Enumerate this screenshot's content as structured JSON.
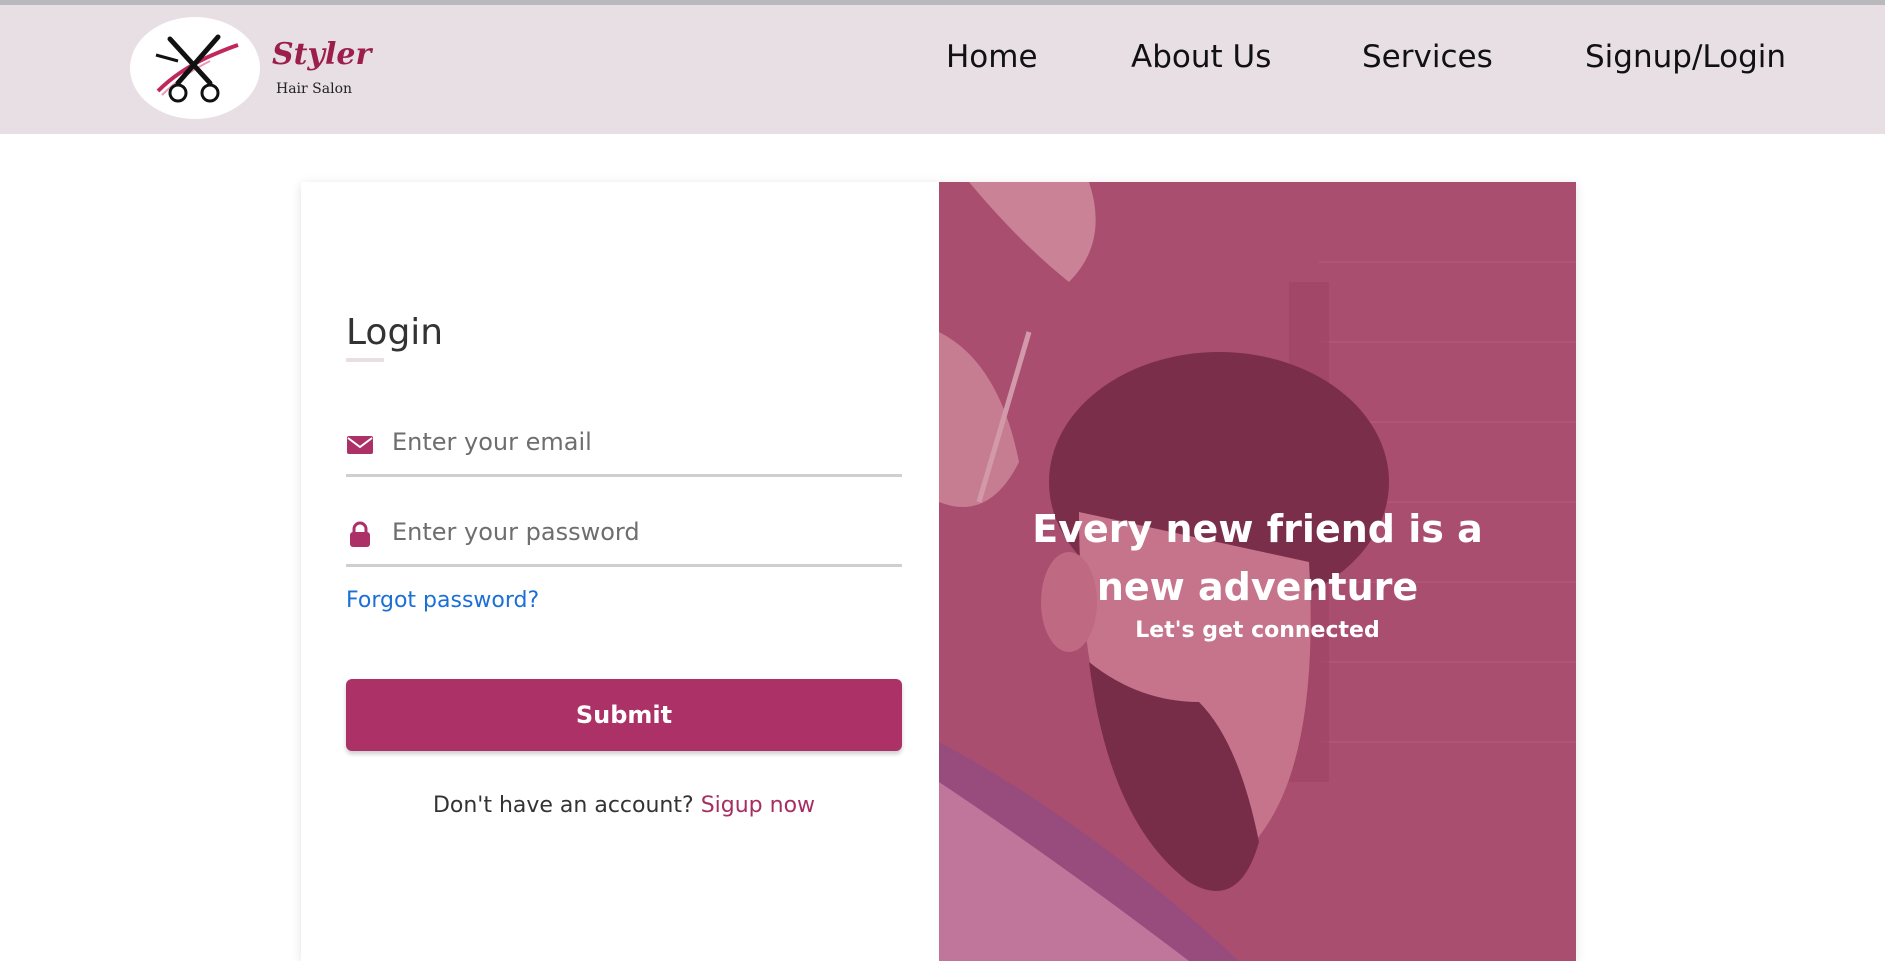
{
  "brand": {
    "name": "Styler",
    "tagline": "Hair Salon",
    "logo_icon": "scissors-icon"
  },
  "nav": {
    "items": [
      {
        "label": "Home"
      },
      {
        "label": "About Us"
      },
      {
        "label": "Services"
      },
      {
        "label": "Signup/Login"
      }
    ]
  },
  "login": {
    "title": "Login",
    "email": {
      "placeholder": "Enter your email",
      "value": "",
      "icon": "envelope-icon"
    },
    "password": {
      "placeholder": "Enter your password",
      "value": "",
      "icon": "lock-icon"
    },
    "forgot_label": "Forgot password?",
    "submit_label": "Submit",
    "signup_prompt": "Don't have an account?",
    "signup_link": "Sigup now"
  },
  "hero": {
    "heading": "Every new friend is a new adventure",
    "subheading": "Let's get connected"
  },
  "colors": {
    "accent": "#ab3166",
    "brand": "#9b1e4c",
    "navbar_bg": "#e7dfe4",
    "link": "#1b6fd6"
  }
}
